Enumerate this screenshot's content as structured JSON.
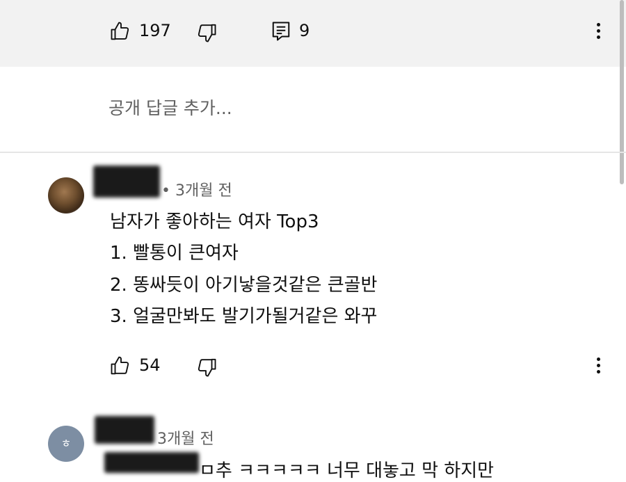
{
  "top_actions": {
    "like_count": "197",
    "reply_count": "9"
  },
  "reply_input": {
    "placeholder": "공개 답글 추가..."
  },
  "comments": [
    {
      "time": "• 3개월 전",
      "lines": [
        "남자가 좋아하는 여자 Top3",
        "1. 빨통이 큰여자",
        "2. 똥싸듯이 아기낳을것같은 큰골반",
        "3. 얼굴만봐도 발기가될거같은 와꾸"
      ],
      "like_count": "54"
    },
    {
      "avatar_letter": "ㅎ",
      "time": "3개월 전",
      "partial_text": "ㅁ추 ㅋㅋㅋㅋㅋ 너무 대놓고 막 하지만"
    }
  ],
  "icons": {
    "like": "thumbs-up-icon",
    "dislike": "thumbs-down-icon",
    "reply": "comment-icon",
    "menu": "more-vertical-icon"
  },
  "colors": {
    "top_band": "#f2f2f2",
    "secondary_text": "#606060",
    "avatar_bg": "#7d8ea3"
  }
}
